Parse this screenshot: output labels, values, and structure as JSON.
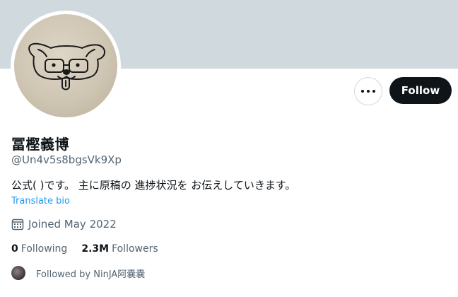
{
  "profile": {
    "display_name": "冨樫義博",
    "handle": "@Un4v5s8bgsVk9Xp",
    "bio": "公式( )です。 主に原稿の 進捗状況を お伝えしていきます。",
    "translate_label": "Translate bio",
    "joined": "Joined May 2022",
    "avatar_icon": "dog-sketch-avatar"
  },
  "actions": {
    "more_icon": "more-horizontal-icon",
    "follow_label": "Follow"
  },
  "stats": {
    "following_count": "0",
    "following_label": "Following",
    "followers_count": "2.3M",
    "followers_label": "Followers"
  },
  "followed_by": {
    "text": "Followed by NinJA阿嚢嚢"
  },
  "colors": {
    "banner": "#cfd9de",
    "primary_text": "#0f1419",
    "secondary_text": "#536471",
    "link": "#1d9bf0",
    "follow_button": "#0f1419"
  }
}
